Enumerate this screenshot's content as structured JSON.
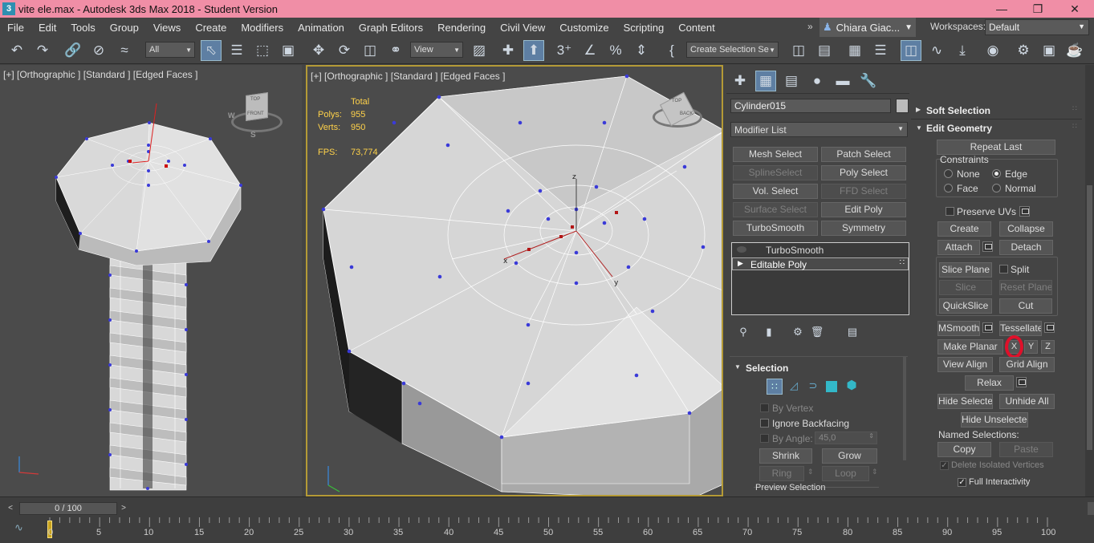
{
  "titlebar": {
    "title": "vite ele.max - Autodesk 3ds Max 2018 - Student Version",
    "icon": "3"
  },
  "menu": [
    "File",
    "Edit",
    "Tools",
    "Group",
    "Views",
    "Create",
    "Modifiers",
    "Animation",
    "Graph Editors",
    "Rendering",
    "Civil View",
    "Customize",
    "Scripting",
    "Content"
  ],
  "user": {
    "name": "Chiara Giac...",
    "workspaces_label": "Workspaces:",
    "workspace": "Default"
  },
  "toolbar": {
    "filter": "All",
    "coord": "View",
    "selection_set": "Create Selection Se"
  },
  "viewport_left": {
    "label": "[+] [Orthographic ] [Standard ] [Edged Faces ]",
    "viewcube": {
      "top": "TOP",
      "front": "FRONT",
      "south": "S",
      "west": "W"
    }
  },
  "viewport_main": {
    "label": "[+] [Orthographic ] [Standard ] [Edged Faces ]",
    "stats": {
      "total_label": "Total",
      "polys_label": "Polys:",
      "polys": "955",
      "verts_label": "Verts:",
      "verts": "950",
      "fps_label": "FPS:",
      "fps": "73,774"
    },
    "viewcube": {
      "top": "TOP",
      "back": "BACK"
    }
  },
  "command_panel": {
    "object_name": "Cylinder015",
    "modifier_list": "Modifier List",
    "modifier_buttons": [
      {
        "label": "Mesh Select",
        "enabled": true
      },
      {
        "label": "Patch Select",
        "enabled": true
      },
      {
        "label": "SplineSelect",
        "enabled": false
      },
      {
        "label": "Poly Select",
        "enabled": true
      },
      {
        "label": "Vol. Select",
        "enabled": true
      },
      {
        "label": "FFD Select",
        "enabled": false
      },
      {
        "label": "Surface Select",
        "enabled": false
      },
      {
        "label": "Edit Poly",
        "enabled": true
      },
      {
        "label": "TurboSmooth",
        "enabled": true
      },
      {
        "label": "Symmetry",
        "enabled": true
      }
    ],
    "stack": [
      "TurboSmooth",
      "Editable Poly"
    ],
    "selection": {
      "title": "Selection",
      "by_vertex": "By Vertex",
      "ignore_backfacing": "Ignore Backfacing",
      "by_angle": "By Angle:",
      "angle_value": "45,0",
      "shrink": "Shrink",
      "grow": "Grow",
      "ring": "Ring",
      "loop": "Loop",
      "preview": "Preview Selection"
    }
  },
  "edit_geometry": {
    "soft_selection": "Soft Selection",
    "title": "Edit Geometry",
    "repeat_last": "Repeat Last",
    "constraints": "Constraints",
    "none": "None",
    "edge": "Edge",
    "face": "Face",
    "normal": "Normal",
    "preserve_uvs": "Preserve UVs",
    "create": "Create",
    "collapse": "Collapse",
    "attach": "Attach",
    "detach": "Detach",
    "slice_plane": "Slice Plane",
    "split": "Split",
    "slice": "Slice",
    "reset_plane": "Reset Plane",
    "quickslice": "QuickSlice",
    "cut": "Cut",
    "msmooth": "MSmooth",
    "tessellate": "Tessellate",
    "make_planar": "Make Planar",
    "x": "X",
    "y": "Y",
    "z": "Z",
    "view_align": "View Align",
    "grid_align": "Grid Align",
    "relax": "Relax",
    "hide_selected": "Hide Selected",
    "unhide_all": "Unhide All",
    "hide_unselected": "Hide Unselected",
    "named_selections": "Named Selections:",
    "copy": "Copy",
    "paste": "Paste",
    "delete_isolated": "Delete Isolated Vertices",
    "full_interactivity": "Full Interactivity"
  },
  "timeline": {
    "frame": "0 / 100",
    "ticks": [
      "0",
      "5",
      "10",
      "15",
      "20",
      "25",
      "30",
      "35",
      "40",
      "45",
      "50",
      "55",
      "60",
      "65",
      "70",
      "75",
      "80",
      "85",
      "90",
      "95",
      "100"
    ]
  },
  "colors": {
    "titlebar": "#f08ea6",
    "highlight_circle": "#e0102a",
    "active_border": "#b49a36",
    "vertex": "#3a3ad8"
  }
}
